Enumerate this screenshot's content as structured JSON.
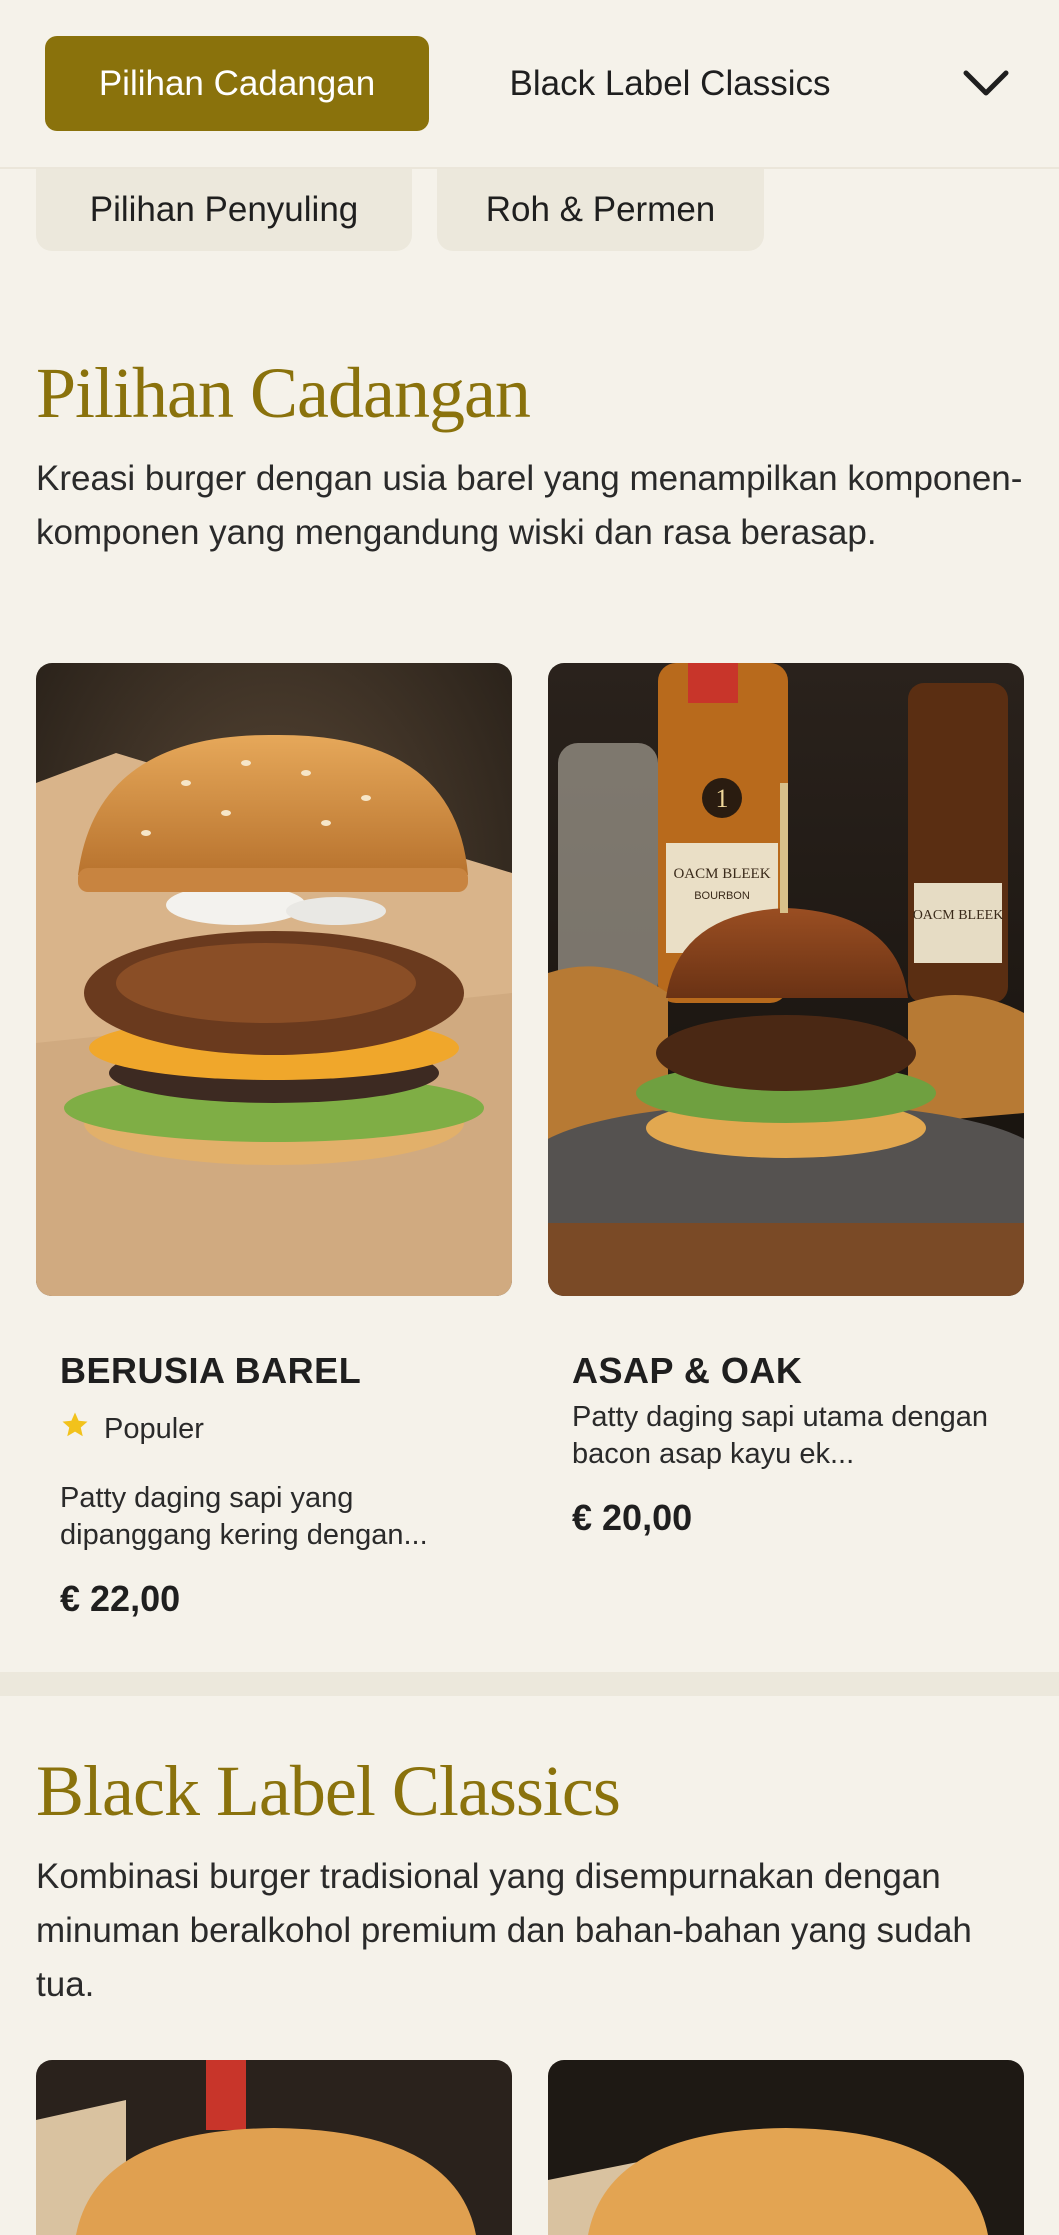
{
  "nav": {
    "active_tab": "Pilihan Cadangan",
    "next_tab": "Black Label Classics",
    "chips": [
      "Pilihan Penyuling",
      "Roh & Permen"
    ]
  },
  "sections": [
    {
      "title": "Pilihan Cadangan",
      "description": "Kreasi burger dengan usia barel yang menampilkan komponen-komponen yang mengandung wiski dan rasa berasap.",
      "items": [
        {
          "name": "BERUSIA BAREL",
          "badge": "Populer",
          "description": "Patty daging sapi yang dipanggang kering dengan...",
          "price": "€ 22,00"
        },
        {
          "name": "ASAP & OAK",
          "description": "Patty daging sapi utama dengan bacon asap kayu ek...",
          "price": "€ 20,00"
        }
      ]
    },
    {
      "title": "Black Label Classics",
      "description": "Kombinasi burger tradisional yang disempurnakan dengan minuman beralkohol premium dan bahan-bahan yang sudah tua."
    }
  ],
  "bottle_labels": [
    "1",
    "OACM BLEEK",
    "BOURBON",
    "OACM BLEEK"
  ],
  "colors": {
    "accent": "#8a720c",
    "background": "#f5f2ea",
    "star": "#f2c21b"
  },
  "icons": {
    "dropdown": "chevron-down-icon",
    "badge": "star-icon"
  }
}
